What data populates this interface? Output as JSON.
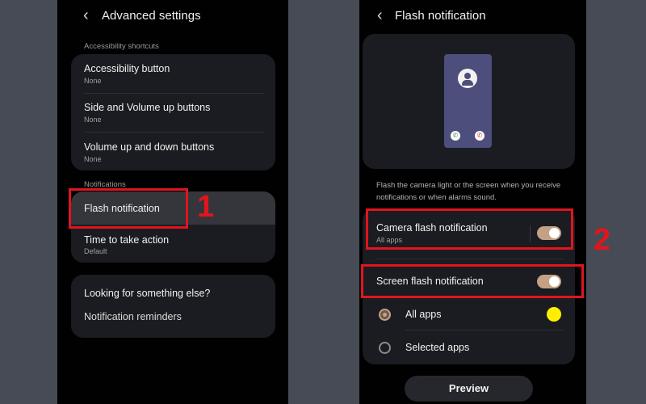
{
  "left": {
    "title": "Advanced settings",
    "section_shortcuts": "Accessibility shortcuts",
    "shortcuts": [
      {
        "label": "Accessibility button",
        "value": "None"
      },
      {
        "label": "Side and Volume up buttons",
        "value": "None"
      },
      {
        "label": "Volume up and down buttons",
        "value": "None"
      }
    ],
    "section_notifications": "Notifications",
    "notifications": [
      {
        "label": "Flash notification"
      },
      {
        "label": "Time to take action",
        "value": "Default"
      }
    ],
    "looking_title": "Looking for something else?",
    "looking_link": "Notification reminders",
    "step_label": "1"
  },
  "right": {
    "title": "Flash notification",
    "description": "Flash the camera light or the screen when you receive notifications or when alarms sound.",
    "camera_flash": {
      "label": "Camera flash notification",
      "value": "All apps",
      "enabled": true
    },
    "screen_flash": {
      "label": "Screen flash notification",
      "enabled": true
    },
    "options": [
      {
        "label": "All apps",
        "selected": true
      },
      {
        "label": "Selected apps",
        "selected": false
      }
    ],
    "selected_color": "#ffee00",
    "preview_button": "Preview",
    "step_label": "2"
  },
  "colors": {
    "highlight": "#e0151e",
    "toggle_on": "#c4a085",
    "card": "#1b1c21",
    "background": "#474b55"
  }
}
